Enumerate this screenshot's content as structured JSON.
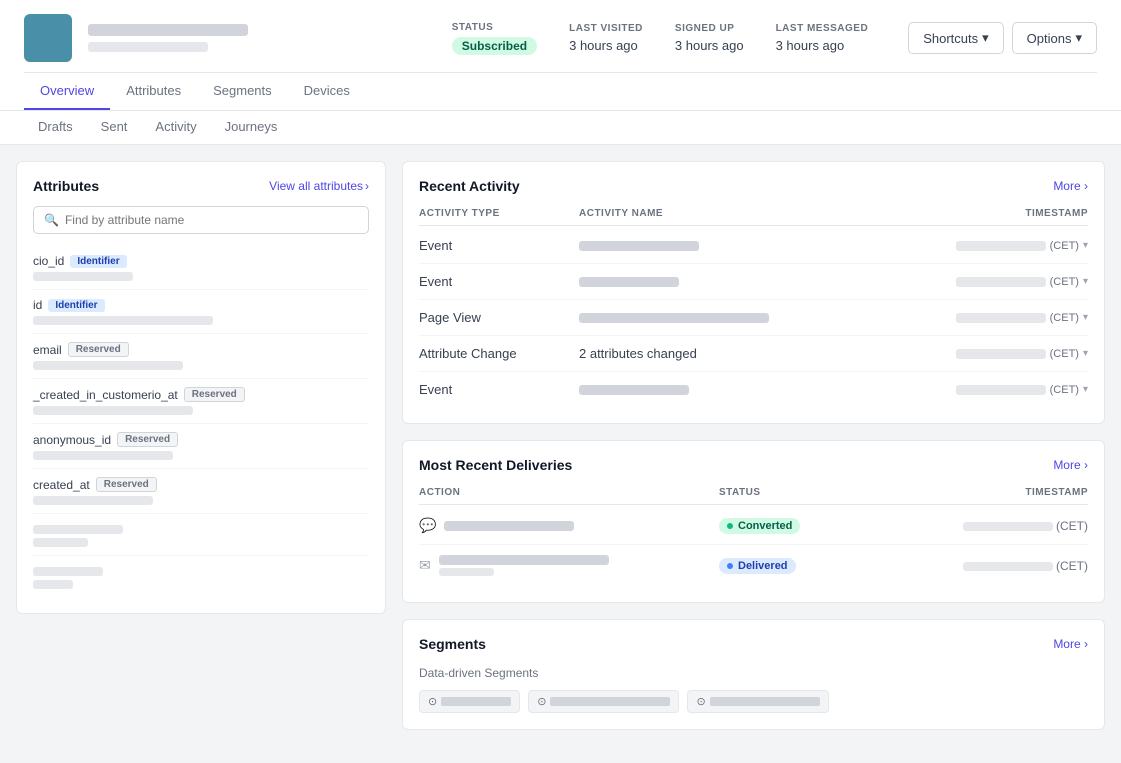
{
  "header": {
    "user_name_placeholder": true,
    "status_label": "STATUS",
    "status_value": "Subscribed",
    "last_visited_label": "LAST VISITED",
    "last_visited_value": "3 hours ago",
    "signed_up_label": "SIGNED UP",
    "signed_up_value": "3 hours ago",
    "last_messaged_label": "LAST MESSAGED",
    "last_messaged_value": "3 hours ago",
    "shortcuts_label": "Shortcuts",
    "options_label": "Options"
  },
  "primary_nav": {
    "tabs": [
      "Overview",
      "Attributes",
      "Segments",
      "Devices"
    ]
  },
  "secondary_nav": {
    "tabs": [
      "Drafts",
      "Sent",
      "Activity",
      "Journeys"
    ]
  },
  "attributes_panel": {
    "title": "Attributes",
    "view_all": "View all attributes",
    "search_placeholder": "Find by attribute name",
    "items": [
      {
        "name": "cio_id",
        "badge": "Identifier",
        "badge_type": "identifier",
        "value_width": "100"
      },
      {
        "name": "id",
        "badge": "Identifier",
        "badge_type": "identifier",
        "value_width": "180"
      },
      {
        "name": "email",
        "badge": "Reserved",
        "badge_type": "reserved",
        "value_width": "150"
      },
      {
        "name": "_created_in_customerio_at",
        "badge": "Reserved",
        "badge_type": "reserved",
        "value_width": "160"
      },
      {
        "name": "anonymous_id",
        "badge": "Reserved",
        "badge_type": "reserved",
        "value_width": "140"
      },
      {
        "name": "created_at",
        "badge": "Reserved",
        "badge_type": "reserved",
        "value_width": "120"
      },
      {
        "name": "",
        "badge": "",
        "badge_type": "",
        "value_width": "90"
      },
      {
        "name": "",
        "badge": "",
        "badge_type": "",
        "value_width": "70"
      }
    ]
  },
  "recent_activity": {
    "title": "Recent Activity",
    "more_label": "More",
    "col_type": "ACTIVITY TYPE",
    "col_name": "ACTIVITY NAME",
    "col_ts": "TIMESTAMP",
    "rows": [
      {
        "type": "Event",
        "name_width": "120",
        "ts_width": "110"
      },
      {
        "type": "Event",
        "name_width": "100",
        "ts_width": "110"
      },
      {
        "type": "Page View",
        "name_width": "190",
        "ts_width": "110"
      },
      {
        "type": "Attribute Change",
        "name_value": "2 attributes changed",
        "ts_width": "110"
      },
      {
        "type": "Event",
        "name_width": "110",
        "ts_width": "110"
      }
    ]
  },
  "most_recent_deliveries": {
    "title": "Most Recent Deliveries",
    "more_label": "More",
    "col_action": "ACTION",
    "col_status": "STATUS",
    "col_ts": "TIMESTAMP",
    "rows": [
      {
        "icon": "💬",
        "action_width": "130",
        "status": "Converted",
        "status_type": "converted",
        "ts_width": "110"
      },
      {
        "icon": "✉",
        "action_width": "170",
        "action_sub_width": "55",
        "status": "Delivered",
        "status_type": "delivered",
        "ts_width": "110"
      }
    ]
  },
  "segments": {
    "title": "Segments",
    "more_label": "More",
    "data_driven_label": "Data-driven Segments",
    "chips": [
      {
        "width": "70"
      },
      {
        "width": "120"
      },
      {
        "width": "110"
      }
    ]
  }
}
